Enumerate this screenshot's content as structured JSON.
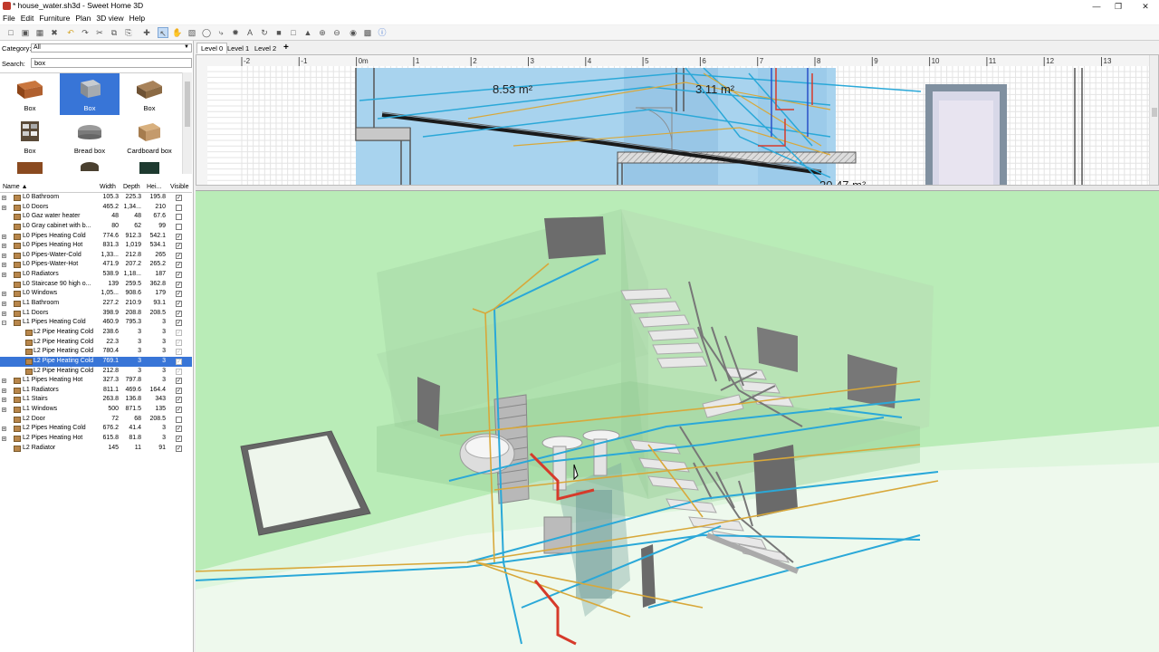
{
  "window": {
    "title": "* house_water.sh3d - Sweet Home 3D"
  },
  "menu": [
    "File",
    "Edit",
    "Furniture",
    "Plan",
    "3D view",
    "Help"
  ],
  "catalog": {
    "category_label": "Category:",
    "category_value": "All",
    "search_label": "Search:",
    "search_value": "box",
    "items": [
      {
        "name": "Box",
        "icon": "box-brown-icon",
        "color": "#b0602f"
      },
      {
        "name": "Box",
        "icon": "box-gray-icon",
        "color": "#9ea3a8"
      },
      {
        "name": "Box",
        "icon": "box-wood-icon",
        "color": "#8b6a44"
      },
      {
        "name": "Box",
        "icon": "box-shelf-icon",
        "color": "#5a4a38"
      },
      {
        "name": "Bread box",
        "icon": "bread-box-icon",
        "color": "#8e8e8e"
      },
      {
        "name": "Cardboard box",
        "icon": "cardboard-box-icon",
        "color": "#c49a6c"
      }
    ],
    "selected_index": 1
  },
  "furniture_table": {
    "columns": [
      "Name ▲",
      "Width",
      "Depth",
      "Hei...",
      "Visible"
    ],
    "rows": [
      {
        "indent": 0,
        "expand": "+",
        "name": "L0 Bathroom",
        "width": "105.3",
        "depth": "225.3",
        "height": "195.8",
        "visible": true
      },
      {
        "indent": 0,
        "expand": "+",
        "name": "L0 Doors",
        "width": "465.2",
        "depth": "1,34...",
        "height": "210",
        "visible": false
      },
      {
        "indent": 0,
        "expand": "",
        "name": "L0 Gaz water heater",
        "width": "48",
        "depth": "48",
        "height": "67.6",
        "visible": false
      },
      {
        "indent": 0,
        "expand": "",
        "name": "L0 Gray cabinet with b...",
        "width": "80",
        "depth": "62",
        "height": "99",
        "visible": false
      },
      {
        "indent": 0,
        "expand": "+",
        "name": "L0 Pipes Heating Cold",
        "width": "774.6",
        "depth": "912.3",
        "height": "542.1",
        "visible": true
      },
      {
        "indent": 0,
        "expand": "+",
        "name": "L0 Pipes Heating Hot",
        "width": "831.3",
        "depth": "1,019",
        "height": "534.1",
        "visible": true
      },
      {
        "indent": 0,
        "expand": "+",
        "name": "L0 Pipes-Water-Cold",
        "width": "1,33...",
        "depth": "212.8",
        "height": "265",
        "visible": true
      },
      {
        "indent": 0,
        "expand": "+",
        "name": "L0 Pipes-Water-Hot",
        "width": "471.9",
        "depth": "207.2",
        "height": "265.2",
        "visible": true
      },
      {
        "indent": 0,
        "expand": "+",
        "name": "L0 Radiators",
        "width": "538.9",
        "depth": "1,18...",
        "height": "187",
        "visible": true
      },
      {
        "indent": 0,
        "expand": "",
        "name": "L0 Staircase 90 high o...",
        "width": "139",
        "depth": "259.5",
        "height": "362.8",
        "visible": true
      },
      {
        "indent": 0,
        "expand": "+",
        "name": "L0 Windows",
        "width": "1,05...",
        "depth": "908.6",
        "height": "179",
        "visible": true
      },
      {
        "indent": 0,
        "expand": "+",
        "name": "L1 Bathroom",
        "width": "227.2",
        "depth": "210.9",
        "height": "93.1",
        "visible": true
      },
      {
        "indent": 0,
        "expand": "+",
        "name": "L1 Doors",
        "width": "398.9",
        "depth": "208.8",
        "height": "208.5",
        "visible": true
      },
      {
        "indent": 0,
        "expand": "−",
        "name": "L1 Pipes Heating Cold",
        "width": "460.9",
        "depth": "795.3",
        "height": "3",
        "visible": true
      },
      {
        "indent": 1,
        "expand": "",
        "name": "L2 Pipe Heating Cold",
        "width": "238.6",
        "depth": "3",
        "height": "3",
        "visible": true
      },
      {
        "indent": 1,
        "expand": "",
        "name": "L2 Pipe Heating Cold",
        "width": "22.3",
        "depth": "3",
        "height": "3",
        "visible": true
      },
      {
        "indent": 1,
        "expand": "",
        "name": "L2 Pipe Heating Cold",
        "width": "780.4",
        "depth": "3",
        "height": "3",
        "visible": true
      },
      {
        "indent": 1,
        "expand": "",
        "name": "L2 Pipe Heating Cold",
        "width": "769.1",
        "depth": "3",
        "height": "3",
        "visible": true,
        "selected": true
      },
      {
        "indent": 1,
        "expand": "",
        "name": "L2 Pipe Heating Cold",
        "width": "212.8",
        "depth": "3",
        "height": "3",
        "visible": true
      },
      {
        "indent": 0,
        "expand": "+",
        "name": "L1 Pipes Heating Hot",
        "width": "327.3",
        "depth": "797.8",
        "height": "3",
        "visible": true
      },
      {
        "indent": 0,
        "expand": "+",
        "name": "L1 Radiators",
        "width": "811.1",
        "depth": "469.6",
        "height": "164.4",
        "visible": true
      },
      {
        "indent": 0,
        "expand": "+",
        "name": "L1 Stairs",
        "width": "263.8",
        "depth": "136.8",
        "height": "343",
        "visible": true
      },
      {
        "indent": 0,
        "expand": "+",
        "name": "L1 Windows",
        "width": "500",
        "depth": "871.5",
        "height": "135",
        "visible": true
      },
      {
        "indent": 0,
        "expand": "",
        "name": "L2 Door",
        "width": "72",
        "depth": "68",
        "height": "208.5",
        "visible": false
      },
      {
        "indent": 0,
        "expand": "+",
        "name": "L2 Pipes Heating Cold",
        "width": "676.2",
        "depth": "41.4",
        "height": "3",
        "visible": true
      },
      {
        "indent": 0,
        "expand": "+",
        "name": "L2 Pipes Heating Hot",
        "width": "615.8",
        "depth": "81.8",
        "height": "3",
        "visible": true
      },
      {
        "indent": 0,
        "expand": "",
        "name": "L2 Radiator",
        "width": "145",
        "depth": "11",
        "height": "91",
        "visible": true
      }
    ]
  },
  "plan": {
    "levels": [
      "Level 0",
      "Level 1",
      "Level 2"
    ],
    "active_level": "Level 0",
    "add_level": "+",
    "ruler": [
      "-2",
      "-1",
      "0m",
      "1",
      "2",
      "3",
      "4",
      "5",
      "6",
      "7",
      "8",
      "9",
      "10",
      "11",
      "12",
      "13"
    ],
    "room_areas": [
      "8.53 m²",
      "3.11 m²",
      "20.47 m²"
    ]
  },
  "toolbar_icons": [
    "new-icon",
    "open-icon",
    "save-icon",
    "cut-icon",
    "undo-icon",
    "redo-icon",
    "cut2-icon",
    "copy-icon",
    "paste-icon",
    "add-furniture-icon",
    "select-icon",
    "pan-icon",
    "create-walls-icon",
    "create-rooms-icon",
    "create-polylines-icon",
    "create-dimensions-icon",
    "add-text-icon",
    "zoom-in-icon",
    "zoom-out-icon",
    "create-photo-icon",
    "create-video-icon",
    "help-icon"
  ],
  "colors": {
    "selection": "#3875d7",
    "pipe_cold": "#2aa8d8",
    "pipe_hot": "#d63a2a",
    "pipe_gas": "#d8a83a",
    "view_bg": "#b9ecb7"
  }
}
